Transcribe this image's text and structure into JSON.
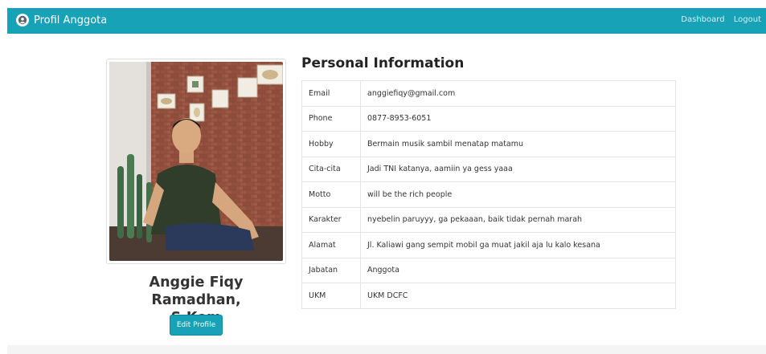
{
  "navbar": {
    "title": "Profil Anggota",
    "icon": "user-circle-icon",
    "links": [
      "Dashboard",
      "Logout"
    ],
    "color": "#17a2b8"
  },
  "profile": {
    "name_line1": "Anggie Fiqy Ramadhan,",
    "name_line2": "S.Kom",
    "edit_label": "Edit Profile",
    "photo_alt": "profile-photo"
  },
  "info": {
    "heading": "Personal Information",
    "rows": [
      {
        "label": "Email",
        "value": "anggiefiqy@gmail.com"
      },
      {
        "label": "Phone",
        "value": "0877-8953-6051"
      },
      {
        "label": "Hobby",
        "value": "Bermain musik sambil menatap matamu"
      },
      {
        "label": "Cita-cita",
        "value": "Jadi TNI katanya, aamiin ya gess yaaa"
      },
      {
        "label": "Motto",
        "value": "will be the rich people"
      },
      {
        "label": "Karakter",
        "value": "nyebelin paruyyy, ga pekaaan, baik tidak pernah marah"
      },
      {
        "label": "Alamat",
        "value": "Jl. Kaliawi gang sempit mobil ga muat jakil aja lu kalo kesana"
      },
      {
        "label": "Jabatan",
        "value": "Anggota"
      },
      {
        "label": "UKM",
        "value": "UKM DCFC"
      }
    ]
  }
}
